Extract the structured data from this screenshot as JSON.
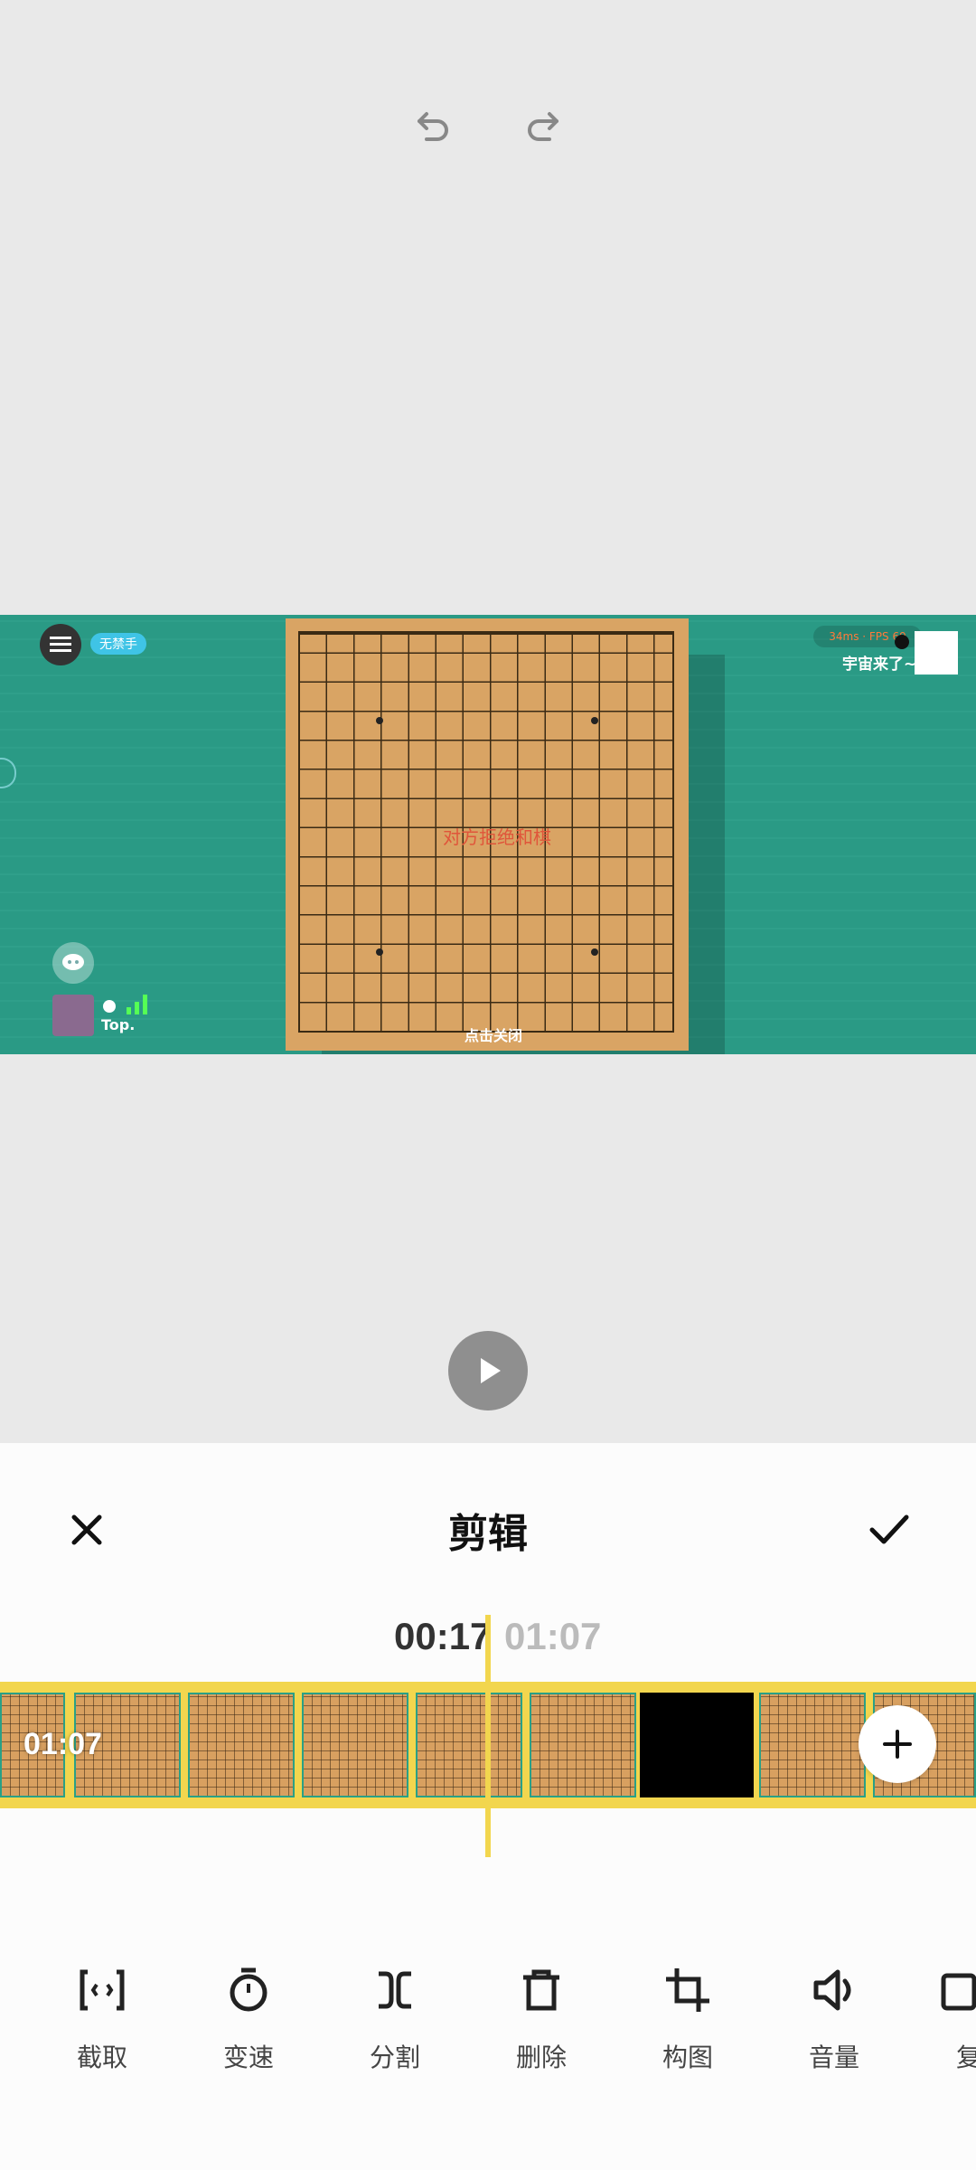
{
  "toolbar_top": {
    "undo_icon": "undo-icon",
    "redo_icon": "redo-icon"
  },
  "preview": {
    "badge": "无禁手",
    "ping_fps": "34ms · FPS 69",
    "opponent_name": "宇宙来了~",
    "center_message": "对方拒绝和棋",
    "close_message": "点击关闭",
    "player_label": "Top."
  },
  "editor": {
    "title": "剪辑",
    "close_icon": "close-icon",
    "confirm_icon": "check-icon",
    "current_time": "00:17",
    "total_time": "01:07",
    "clip_duration": "01:07"
  },
  "tools": [
    {
      "label": "截取",
      "icon": "trim-icon"
    },
    {
      "label": "变速",
      "icon": "speed-icon"
    },
    {
      "label": "分割",
      "icon": "split-icon"
    },
    {
      "label": "删除",
      "icon": "delete-icon"
    },
    {
      "label": "构图",
      "icon": "crop-icon"
    },
    {
      "label": "音量",
      "icon": "volume-icon"
    },
    {
      "label": "复",
      "icon": "copy-icon"
    }
  ],
  "colors": {
    "accent": "#f2d64e",
    "board": "#d9a464",
    "table": "#2a9a85"
  }
}
